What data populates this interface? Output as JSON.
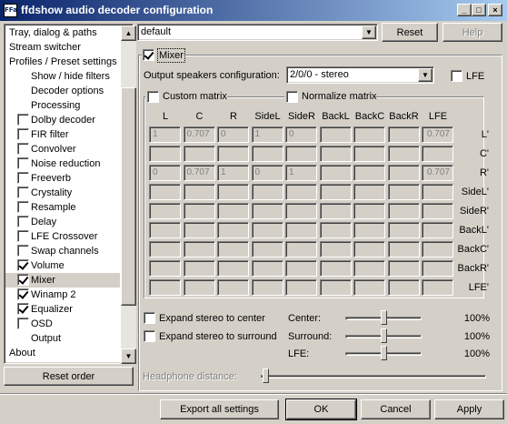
{
  "window": {
    "title": "ffdshow audio decoder configuration",
    "icon_text": "FFa",
    "controls": [
      "_",
      "□",
      "×"
    ]
  },
  "tree": {
    "items": [
      {
        "label": "Tray, dialog & paths",
        "indent": 0,
        "checkbox": false
      },
      {
        "label": "Stream switcher",
        "indent": 0,
        "checkbox": false
      },
      {
        "label": "Profiles / Preset settings",
        "indent": 0,
        "checkbox": false
      },
      {
        "label": "Show / hide filters",
        "indent": 2,
        "checkbox": false
      },
      {
        "label": "Decoder options",
        "indent": 2,
        "checkbox": false
      },
      {
        "label": "Processing",
        "indent": 2,
        "checkbox": false
      },
      {
        "label": "Dolby decoder",
        "indent": 1,
        "checkbox": true,
        "checked": false
      },
      {
        "label": "FIR filter",
        "indent": 1,
        "checkbox": true,
        "checked": false
      },
      {
        "label": "Convolver",
        "indent": 1,
        "checkbox": true,
        "checked": false
      },
      {
        "label": "Noise reduction",
        "indent": 1,
        "checkbox": true,
        "checked": false
      },
      {
        "label": "Freeverb",
        "indent": 1,
        "checkbox": true,
        "checked": false
      },
      {
        "label": "Crystality",
        "indent": 1,
        "checkbox": true,
        "checked": false
      },
      {
        "label": "Resample",
        "indent": 1,
        "checkbox": true,
        "checked": false
      },
      {
        "label": "Delay",
        "indent": 1,
        "checkbox": true,
        "checked": false
      },
      {
        "label": "LFE Crossover",
        "indent": 1,
        "checkbox": true,
        "checked": false
      },
      {
        "label": "Swap channels",
        "indent": 1,
        "checkbox": true,
        "checked": false
      },
      {
        "label": "Volume",
        "indent": 1,
        "checkbox": true,
        "checked": true
      },
      {
        "label": "Mixer",
        "indent": 1,
        "checkbox": true,
        "checked": true,
        "selected": true
      },
      {
        "label": "Winamp 2",
        "indent": 1,
        "checkbox": true,
        "checked": true
      },
      {
        "label": "Equalizer",
        "indent": 1,
        "checkbox": true,
        "checked": true
      },
      {
        "label": "OSD",
        "indent": 1,
        "checkbox": true,
        "checked": false
      },
      {
        "label": "Output",
        "indent": 2,
        "checkbox": false
      },
      {
        "label": "About",
        "indent": 0,
        "checkbox": false
      }
    ],
    "reset_order_label": "Reset order"
  },
  "preset": {
    "value": "default",
    "reset_label": "Reset",
    "help_label": "Help"
  },
  "mixer": {
    "enabled_label": "Mixer",
    "enabled": true,
    "output_label": "Output speakers configuration:",
    "output_value": "2/0/0 - stereo",
    "lfe_label": "LFE",
    "custom_matrix_label": "Custom matrix",
    "normalize_matrix_label": "Normalize matrix",
    "columns": [
      "L",
      "C",
      "R",
      "SideL",
      "SideR",
      "BackL",
      "BackC",
      "BackR",
      "LFE"
    ],
    "rows": [
      "L'",
      "C'",
      "R'",
      "SideL'",
      "SideR'",
      "BackL'",
      "BackC'",
      "BackR'",
      "LFE'"
    ],
    "matrix": [
      [
        "1",
        "0.707",
        "0",
        "1",
        "0",
        "",
        "",
        "",
        "0.707"
      ],
      [
        "",
        "",
        "",
        "",
        "",
        "",
        "",
        "",
        ""
      ],
      [
        "0",
        "0.707",
        "1",
        "0",
        "1",
        "",
        "",
        "",
        "0.707"
      ],
      [
        "",
        "",
        "",
        "",
        "",
        "",
        "",
        "",
        ""
      ],
      [
        "",
        "",
        "",
        "",
        "",
        "",
        "",
        "",
        ""
      ],
      [
        "",
        "",
        "",
        "",
        "",
        "",
        "",
        "",
        ""
      ],
      [
        "",
        "",
        "",
        "",
        "",
        "",
        "",
        "",
        ""
      ],
      [
        "",
        "",
        "",
        "",
        "",
        "",
        "",
        "",
        ""
      ],
      [
        "",
        "",
        "",
        "",
        "",
        "",
        "",
        "",
        ""
      ]
    ],
    "expand_center_label": "Expand stereo to center",
    "expand_surround_label": "Expand stereo to surround",
    "sliders": [
      {
        "label": "Center:",
        "value": "100%",
        "level": 0.5
      },
      {
        "label": "Surround:",
        "value": "100%",
        "level": 0.5
      },
      {
        "label": "LFE:",
        "value": "100%",
        "level": 0.5
      }
    ],
    "headphone_label": "Headphone distance:"
  },
  "footer": {
    "export_label": "Export all settings",
    "ok_label": "OK",
    "cancel_label": "Cancel",
    "apply_label": "Apply"
  }
}
